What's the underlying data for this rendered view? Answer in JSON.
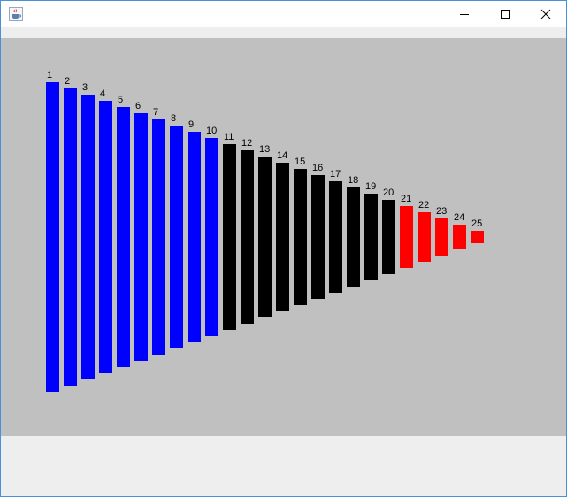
{
  "window": {
    "title": "",
    "icon": "java-cup-icon",
    "controls": {
      "minimize_icon": "minimize-icon",
      "maximize_icon": "maximize-icon",
      "close_icon": "close-icon"
    }
  },
  "canvas": {
    "background": "#c0c0c0",
    "bars": [
      {
        "label": "1",
        "value": 25,
        "color": "#0000ff"
      },
      {
        "label": "2",
        "value": 24,
        "color": "#0000ff"
      },
      {
        "label": "3",
        "value": 23,
        "color": "#0000ff"
      },
      {
        "label": "4",
        "value": 22,
        "color": "#0000ff"
      },
      {
        "label": "5",
        "value": 21,
        "color": "#0000ff"
      },
      {
        "label": "6",
        "value": 20,
        "color": "#0000ff"
      },
      {
        "label": "7",
        "value": 19,
        "color": "#0000ff"
      },
      {
        "label": "8",
        "value": 18,
        "color": "#0000ff"
      },
      {
        "label": "9",
        "value": 17,
        "color": "#0000ff"
      },
      {
        "label": "10",
        "value": 16,
        "color": "#0000ff"
      },
      {
        "label": "11",
        "value": 15,
        "color": "#000000"
      },
      {
        "label": "12",
        "value": 14,
        "color": "#000000"
      },
      {
        "label": "13",
        "value": 13,
        "color": "#000000"
      },
      {
        "label": "14",
        "value": 12,
        "color": "#000000"
      },
      {
        "label": "15",
        "value": 11,
        "color": "#000000"
      },
      {
        "label": "16",
        "value": 10,
        "color": "#000000"
      },
      {
        "label": "17",
        "value": 9,
        "color": "#000000"
      },
      {
        "label": "18",
        "value": 8,
        "color": "#000000"
      },
      {
        "label": "19",
        "value": 7,
        "color": "#000000"
      },
      {
        "label": "20",
        "value": 6,
        "color": "#000000"
      },
      {
        "label": "21",
        "value": 5,
        "color": "#ff0000"
      },
      {
        "label": "22",
        "value": 4,
        "color": "#ff0000"
      },
      {
        "label": "23",
        "value": 3,
        "color": "#ff0000"
      },
      {
        "label": "24",
        "value": 2,
        "color": "#ff0000"
      },
      {
        "label": "25",
        "value": 1,
        "color": "#ff0000"
      }
    ]
  }
}
